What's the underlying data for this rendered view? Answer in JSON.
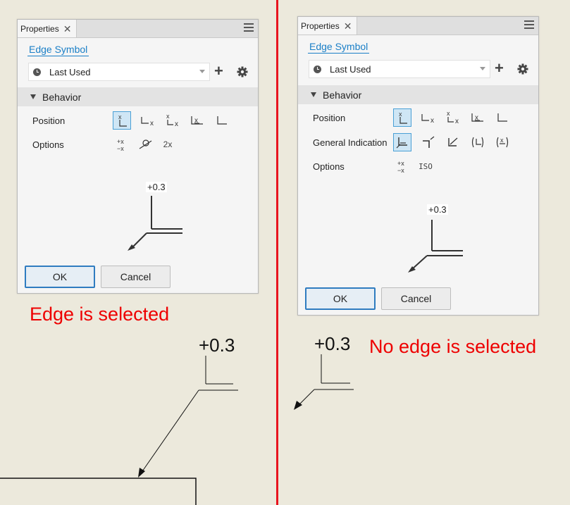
{
  "left_panel": {
    "tab_label": "Properties",
    "link": "Edge Symbol",
    "preset": "Last Used",
    "section": "Behavior",
    "rows": {
      "position": "Position",
      "options": "Options"
    },
    "option_text": "2x",
    "preview_value": "+0.3",
    "ok": "OK",
    "cancel": "Cancel"
  },
  "right_panel": {
    "tab_label": "Properties",
    "link": "Edge Symbol",
    "preset": "Last Used",
    "section": "Behavior",
    "rows": {
      "position": "Position",
      "general": "General Indication",
      "options": "Options"
    },
    "option_text": "ISO",
    "preview_value": "+0.3",
    "ok": "OK",
    "cancel": "Cancel"
  },
  "annotations": {
    "left": "Edge is selected",
    "right": "No edge is selected"
  },
  "canvas": {
    "left_value": "+0.3",
    "right_value": "+0.3"
  },
  "icons": [
    "close-icon",
    "menu-icon",
    "clock-icon",
    "plus-icon",
    "gear-icon",
    "collapse-triangle-icon"
  ],
  "colors": {
    "accent": "#1a7fc7",
    "annotation": "#ee0000",
    "divider": "#e8141f",
    "background": "#ece9dc"
  }
}
